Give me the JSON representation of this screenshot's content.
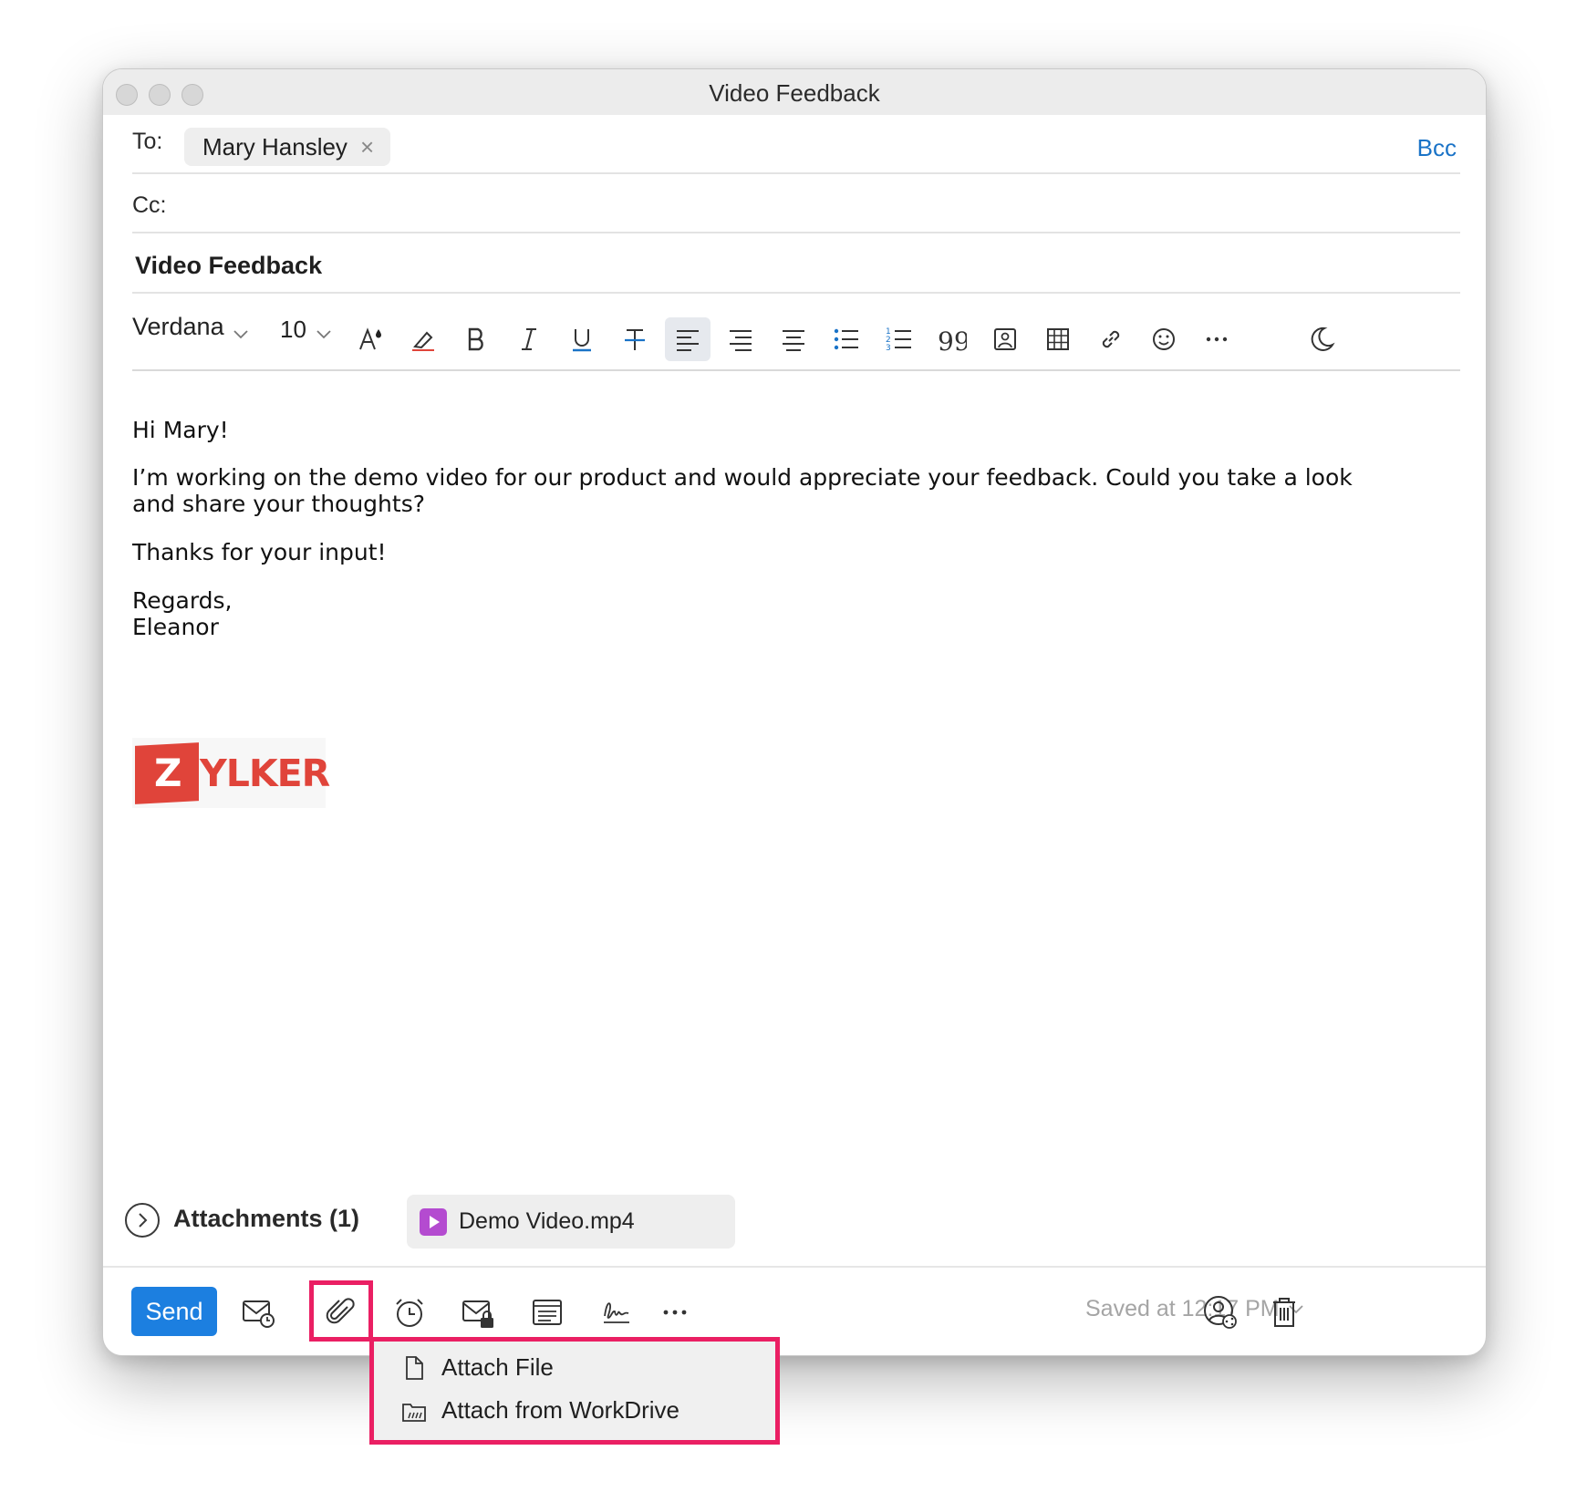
{
  "window": {
    "title": "Video Feedback"
  },
  "header": {
    "to_label": "To:",
    "recipient": "Mary Hansley",
    "recipient_remove": "×",
    "bcc_label": "Bcc",
    "cc_label": "Cc:",
    "subject": "Video Feedback"
  },
  "format_toolbar": {
    "font": "Verdana",
    "size": "10",
    "tools": [
      "font-color-icon",
      "clear-format-icon",
      "bold-icon",
      "italic-icon",
      "underline-icon",
      "strikethrough-icon",
      "align-left-icon",
      "align-center-icon",
      "align-justify-icon",
      "bullet-list-icon",
      "numbered-list-icon",
      "quote-icon",
      "insert-image-icon",
      "insert-table-icon",
      "insert-link-icon",
      "emoji-icon",
      "more-icon",
      "dark-mode-icon"
    ],
    "active_tool": "align-left-icon"
  },
  "body": {
    "greeting": "Hi Mary!",
    "line1": "I’m working on the demo video for our product and would appreciate your feedback. Could you take a look",
    "line2": "and share your thoughts?",
    "thanks": "Thanks for your input!",
    "regards": "Regards,",
    "name": "Eleanor"
  },
  "signature_logo": {
    "text": "ZYLKER",
    "color": "#e0443a"
  },
  "attachments": {
    "label": "Attachments (1)",
    "files": [
      {
        "name": "Demo Video.mp4",
        "icon_color": "#b44bd0"
      }
    ]
  },
  "bottom_toolbar": {
    "send_label": "Send",
    "saved_text": "Saved at 12:17 PM",
    "send_color": "#1c7fe0"
  },
  "attach_menu": {
    "items": [
      {
        "label": "Attach File",
        "icon": "file-icon"
      },
      {
        "label": "Attach from WorkDrive",
        "icon": "workdrive-folder-icon"
      }
    ],
    "highlight_color": "#ea1f63"
  }
}
